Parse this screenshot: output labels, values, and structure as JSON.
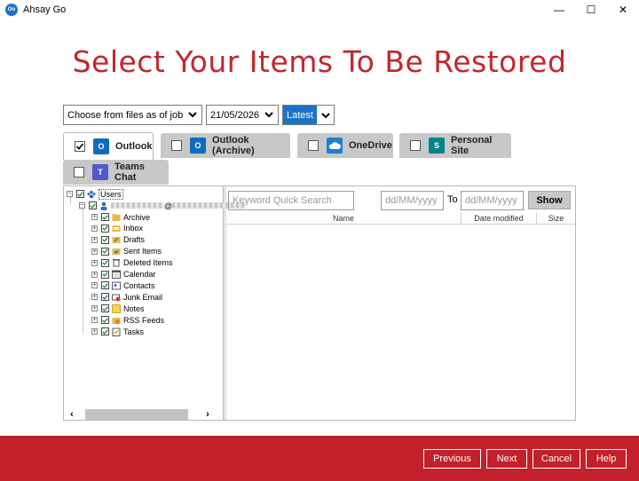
{
  "app": {
    "logo_text": "Go",
    "title": "Ahsay Go"
  },
  "window_controls": {
    "minimize": "—",
    "maximize": "☐",
    "close": "✕"
  },
  "page_title": "Select Your Items To Be Restored",
  "filters": {
    "mode": "Choose from files as of job",
    "date": "21/05/2026",
    "version": "Latest"
  },
  "tabs": [
    {
      "label": "Outlook",
      "icon": "outlook-icon",
      "checked": true,
      "active": true
    },
    {
      "label": "Outlook (Archive)",
      "icon": "outlook-archive-icon",
      "checked": false,
      "active": false
    },
    {
      "label": "OneDrive",
      "icon": "onedrive-icon",
      "checked": false,
      "active": false
    },
    {
      "label": "Personal Site",
      "icon": "sharepoint-icon",
      "checked": false,
      "active": false
    },
    {
      "label": "Teams Chat",
      "icon": "teams-icon",
      "checked": false,
      "active": false
    }
  ],
  "tree": {
    "root_label": "Users",
    "user_suffix": "@",
    "folders": [
      "Archive",
      "Inbox",
      "Drafts",
      "Sent Items",
      "Deleted Items",
      "Calendar",
      "Contacts",
      "Junk Email",
      "Notes",
      "RSS Feeds",
      "Tasks"
    ]
  },
  "search": {
    "placeholder": "Keyword Quick Search",
    "from_placeholder": "dd/MM/yyyy",
    "to_label": "To",
    "to_placeholder": "dd/MM/yyyy",
    "show_label": "Show"
  },
  "columns": [
    "Name",
    "Date modified",
    "Size"
  ],
  "scroll": {
    "left": "‹",
    "right": "›"
  },
  "footer": {
    "previous": "Previous",
    "next": "Next",
    "cancel": "Cancel",
    "help": "Help"
  },
  "colors": {
    "brand_red": "#c0272d",
    "accent_blue": "#1a73c8",
    "footer_red": "#c2202a"
  }
}
